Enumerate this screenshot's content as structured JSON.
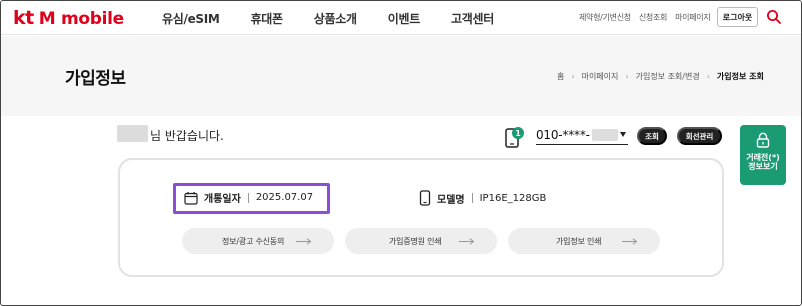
{
  "header": {
    "logo_kt": "kt",
    "logo_m": "M mobile",
    "nav": [
      "유심/eSIM",
      "휴대폰",
      "상품소개",
      "이벤트",
      "고객센터"
    ],
    "util_links": [
      "제약형/기변신청",
      "신청조회",
      "마이페이지"
    ],
    "logout_label": "로그아웃"
  },
  "title_bar": {
    "title": "가입정보",
    "breadcrumb": [
      "홈",
      "마이페이지",
      "가입정보 조회/변경",
      "가입정보 조회"
    ]
  },
  "greeting": {
    "text": "님 반갑습니다."
  },
  "line": {
    "badge_count": "1",
    "phone_number": "010-****-",
    "lookup_label": "조회",
    "line_mgmt_label": "회선관리"
  },
  "side_button": {
    "label": "거래전(*)\n정보보기"
  },
  "info": {
    "open_date_label": "개통일자",
    "open_date_value": "2025.07.07",
    "model_label": "모델명",
    "model_value": "IP16E_128GB"
  },
  "actions": {
    "consent_label": "정보/광고 수신동의",
    "cert_label": "가입증명원 인쇄",
    "print_label": "가입정보 인쇄"
  },
  "colors": {
    "brand_red": "#e0001b",
    "green": "#1a9b74",
    "highlight_purple": "#8a4fd8",
    "badge_green": "#1a9b74"
  }
}
